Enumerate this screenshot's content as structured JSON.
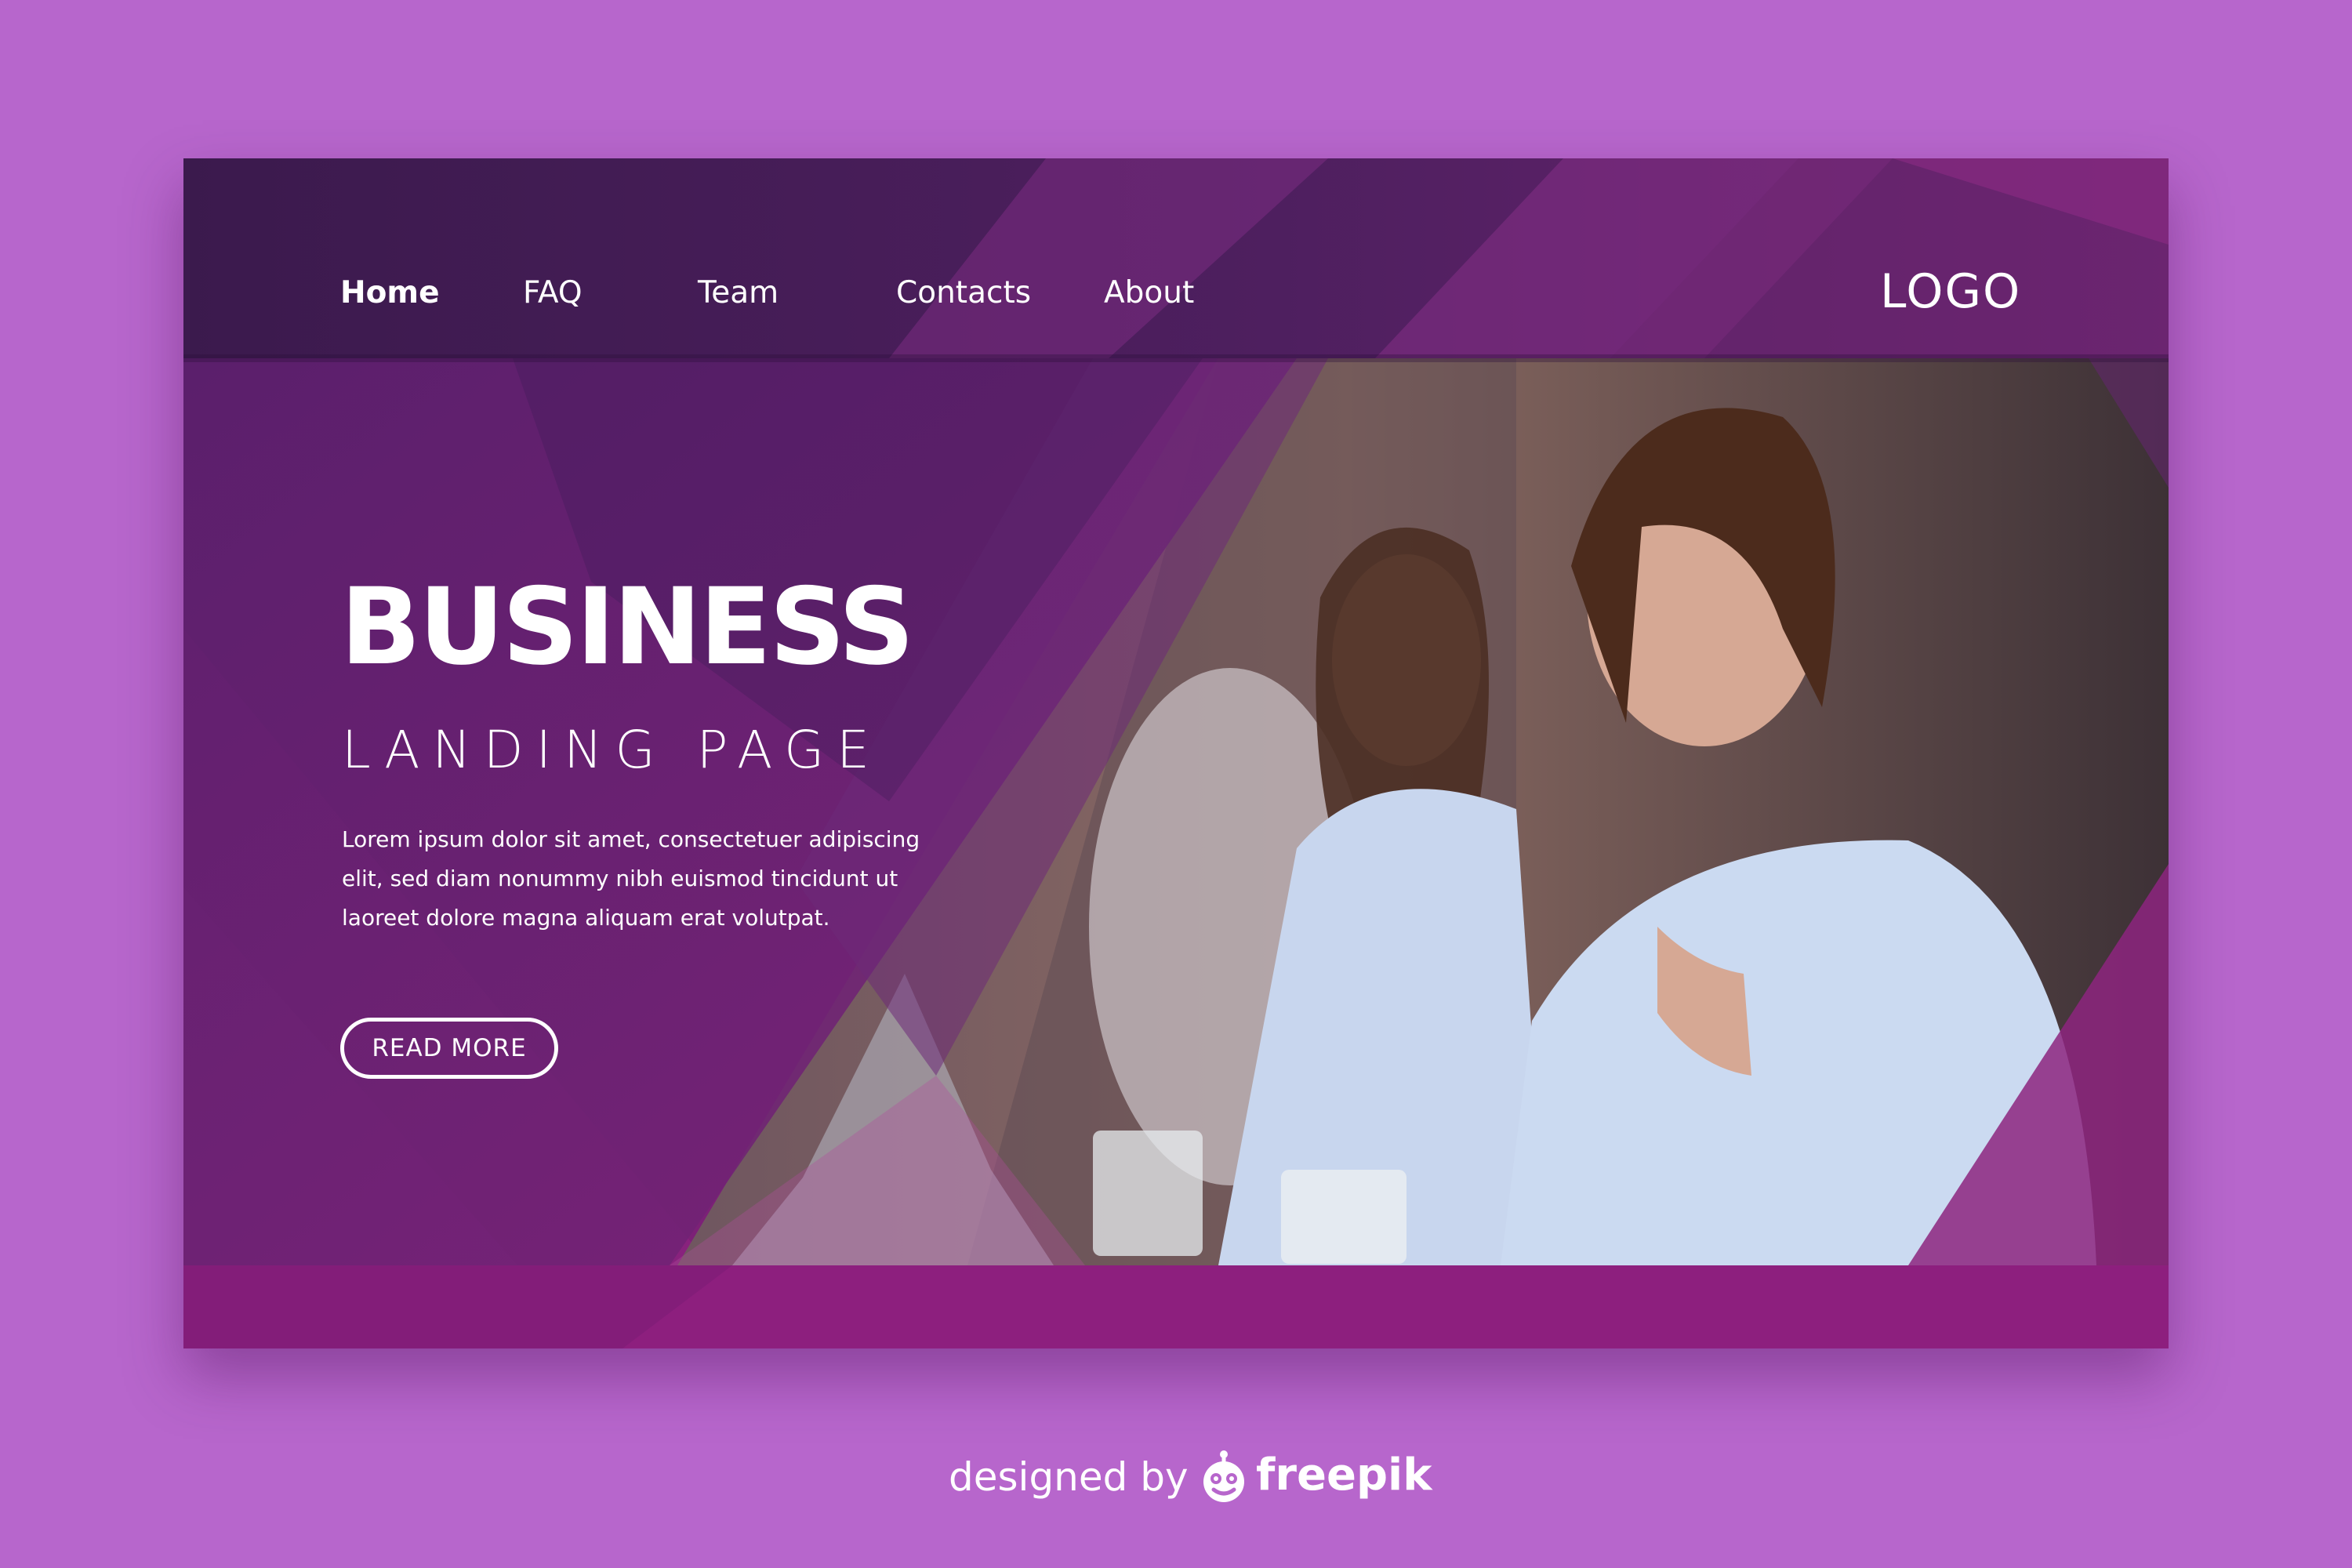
{
  "colors": {
    "page_background": "#b766cc",
    "card_magenta": "#861f7c",
    "deep_purple": "#4c1c5f",
    "accent_purple": "#8e2a8d",
    "text": "#ffffff"
  },
  "nav": {
    "items": [
      {
        "label": "Home",
        "active": true
      },
      {
        "label": "FAQ",
        "active": false
      },
      {
        "label": "Team",
        "active": false
      },
      {
        "label": "Contacts",
        "active": false
      },
      {
        "label": "About",
        "active": false
      }
    ],
    "logo": "LOGO"
  },
  "hero": {
    "title": "BUSINESS",
    "subtitle": "LANDING PAGE",
    "body_lines": [
      "Lorem ipsum dolor sit amet, consectetuer adipiscing",
      "elit, sed diam nonummy nibh euismod tincidunt ut",
      "laoreet dolore magna aliquam erat volutpat."
    ],
    "button_label": "READ MORE",
    "image_icon": "team-photo"
  },
  "footer": {
    "prefix": "designed by",
    "brand": "freepik",
    "brand_icon": "freepik-mascot-icon"
  }
}
